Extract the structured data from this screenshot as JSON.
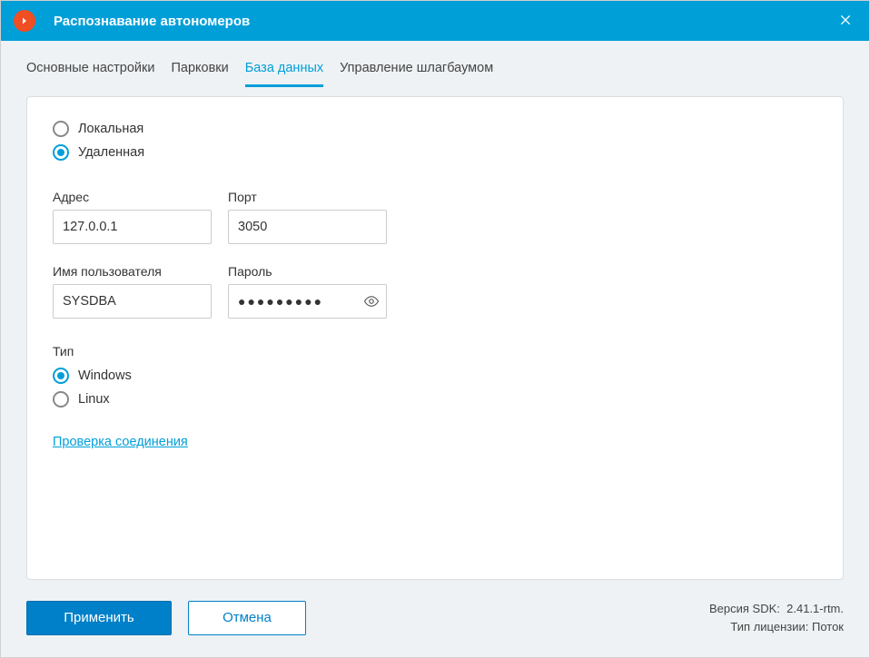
{
  "window": {
    "title": "Распознавание автономеров"
  },
  "tabs": [
    {
      "label": "Основные настройки",
      "active": false
    },
    {
      "label": "Парковки",
      "active": false
    },
    {
      "label": "База данных",
      "active": true
    },
    {
      "label": "Управление шлагбаумом",
      "active": false
    }
  ],
  "dbMode": {
    "local": {
      "label": "Локальная",
      "checked": false
    },
    "remote": {
      "label": "Удаленная",
      "checked": true
    }
  },
  "fields": {
    "address": {
      "label": "Адрес",
      "value": "127.0.0.1"
    },
    "port": {
      "label": "Порт",
      "value": "3050"
    },
    "username": {
      "label": "Имя пользователя",
      "value": "SYSDBA"
    },
    "password": {
      "label": "Пароль",
      "value": "●●●●●●●●●"
    }
  },
  "type": {
    "label": "Тип",
    "windows": {
      "label": "Windows",
      "checked": true
    },
    "linux": {
      "label": "Linux",
      "checked": false
    }
  },
  "testLink": "Проверка соединения",
  "footer": {
    "apply": "Применить",
    "cancel": "Отмена",
    "sdk_label": "Версия SDK:",
    "sdk_value": "2.41.1-rtm.",
    "license_label": "Тип лицензии:",
    "license_value": "Поток"
  }
}
